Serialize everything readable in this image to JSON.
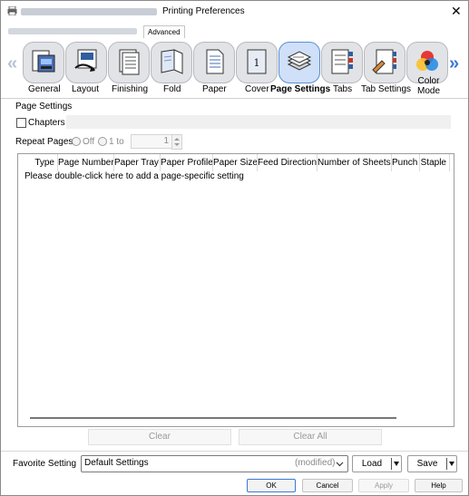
{
  "window": {
    "title": "Printing Preferences",
    "close_glyph": "✕"
  },
  "tabs": {
    "advanced": "Advanced"
  },
  "toolbar": {
    "left_arrow": "«",
    "right_arrow": "»",
    "items": [
      {
        "label": "General",
        "icon": "general-icon"
      },
      {
        "label": "Layout",
        "icon": "layout-icon"
      },
      {
        "label": "Finishing",
        "icon": "finishing-icon"
      },
      {
        "label": "Fold",
        "icon": "fold-icon"
      },
      {
        "label": "Paper",
        "icon": "paper-icon"
      },
      {
        "label": "Cover",
        "icon": "cover-icon",
        "badge": "1"
      },
      {
        "label": "Page Settings",
        "icon": "page-settings-icon",
        "selected": true
      },
      {
        "label": "Tabs",
        "icon": "tabs-icon"
      },
      {
        "label": "Tab Settings",
        "icon": "tab-settings-icon"
      },
      {
        "label": "Color\nMode",
        "icon": "color-mode-icon"
      }
    ]
  },
  "page_settings": {
    "group_label": "Page Settings",
    "chapters_label": "Chapters",
    "repeat_pages_label": "Repeat Pages",
    "off_label": "Off",
    "one_to_label": "1 to",
    "spin_value": "1"
  },
  "table": {
    "columns": [
      "Type",
      "Page Number",
      "Paper Tray",
      "Paper Profile",
      "Paper Size",
      "Feed Direction",
      "Number of Sheets",
      "Punch",
      "Staple"
    ],
    "hint": "Please double-click here to add a page-specific setting"
  },
  "actions": {
    "clear": "Clear",
    "clear_all": "Clear All"
  },
  "favorite": {
    "label": "Favorite Setting",
    "value": "Default Settings",
    "modified": "(modified)",
    "load": "Load",
    "save": "Save"
  },
  "footer": {
    "ok": "OK",
    "cancel": "Cancel",
    "apply": "Apply",
    "help": "Help"
  },
  "colors": {
    "accent": "#3b78d8",
    "selected_tile": "#cfe0f8"
  }
}
